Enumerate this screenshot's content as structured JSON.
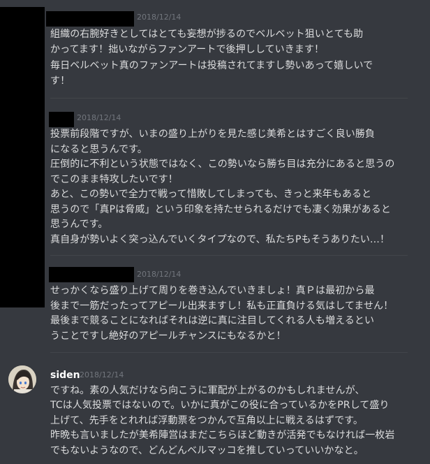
{
  "messages": [
    {
      "username": "",
      "timestamp": "2018/12/14",
      "paragraphs": [
        [
          "組織の右腕好きとしてはとても妄想が捗るのでベルベット狙いとても助",
          "かってます！拙いながらファンアートで後押ししていきます！"
        ],
        [
          "毎日ベルベット真のファンアートは投稿されてますし勢いあって嬉しいで",
          "す！"
        ]
      ]
    },
    {
      "username": "",
      "timestamp": "2018/12/14",
      "paragraphs": [
        [
          "投票前段階ですが、いまの盛り上がりを見た感じ美希とはすごく良い勝負",
          "になると思うんです。"
        ],
        [
          "圧倒的に不利という状態ではなく、この勢いなら勝ち目は充分にあると思うの",
          "でこのまま特攻したいです！"
        ],
        [
          "あと、この勢いで全力で戦って惜敗してしまっても、きっと来年もあると",
          "思うので「真Pは脅威」という印象を持たせられるだけでも凄く効果があると",
          "思うんです。"
        ],
        [
          "真自身が勢いよく突っ込んでいくタイプなので、私たちPもそうありたい…！"
        ]
      ]
    },
    {
      "username": "",
      "timestamp": "2018/12/14",
      "paragraphs": [
        [
          "せっかくなら盛り上げて周りを巻き込んでいきましょ！真Ｐは最初から最",
          "後まで一筋だったってアピール出来ますし！私も正直負ける気はしてません！"
        ],
        [
          "最後まで競ることになればそれは逆に真に注目してくれる人も増えるとい",
          "うことですし絶好のアピールチャンスにもなるかと！"
        ]
      ]
    },
    {
      "username": "siden",
      "timestamp": "2018/12/14",
      "paragraphs": [
        [
          "ですね。素の人気だけなら向こうに軍配が上がるのかもしれませんが、",
          "TCは人気投票ではないので。いかに真がこの役に合っているかをPRして盛り",
          "上げて、先手をとれれば浮動票をつかんで互角以上に戦えるはずです。"
        ],
        [
          "昨晩も言いましたが美希陣営はまだこちらほど動きが活発でもなければ一枚岩",
          "でもないようなので、どんどんベルマッコを推していっていいかなと。"
        ]
      ]
    }
  ]
}
